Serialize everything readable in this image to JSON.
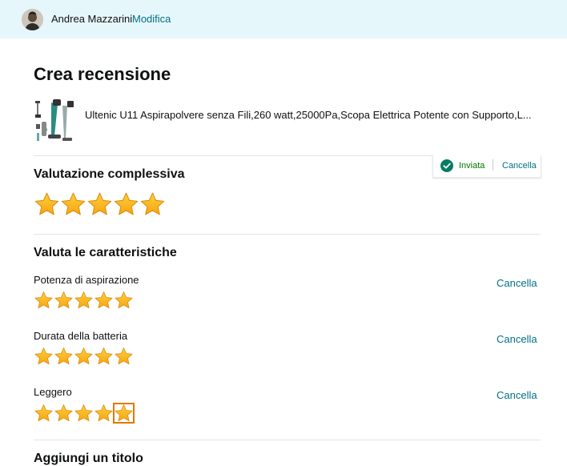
{
  "header": {
    "username": "Andrea Mazzarini",
    "edit_label": "Modifica"
  },
  "page": {
    "title": "Crea recensione"
  },
  "product": {
    "title": "Ultenic U11 Aspirapolvere senza Fili,260 watt,25000Pa,Scopa Elettrica Potente con Supporto,L..."
  },
  "overall": {
    "title": "Valutazione complessiva",
    "rating": 5,
    "max": 5,
    "status_label": "Inviata",
    "cancel_label": "Cancella"
  },
  "features": {
    "title": "Valuta le caratteristiche",
    "items": [
      {
        "label": "Potenza di aspirazione",
        "rating": 5,
        "cancel_label": "Cancella"
      },
      {
        "label": "Durata della batteria",
        "rating": 5,
        "cancel_label": "Cancella"
      },
      {
        "label": "Leggero",
        "rating": 5,
        "cancel_label": "Cancella"
      }
    ]
  },
  "add_title": {
    "title": "Aggiungi un titolo"
  },
  "colors": {
    "accent_link": "#007185",
    "star_fill": "#ffa41c",
    "success": "#007600",
    "header_bg": "#e6f7fb"
  }
}
